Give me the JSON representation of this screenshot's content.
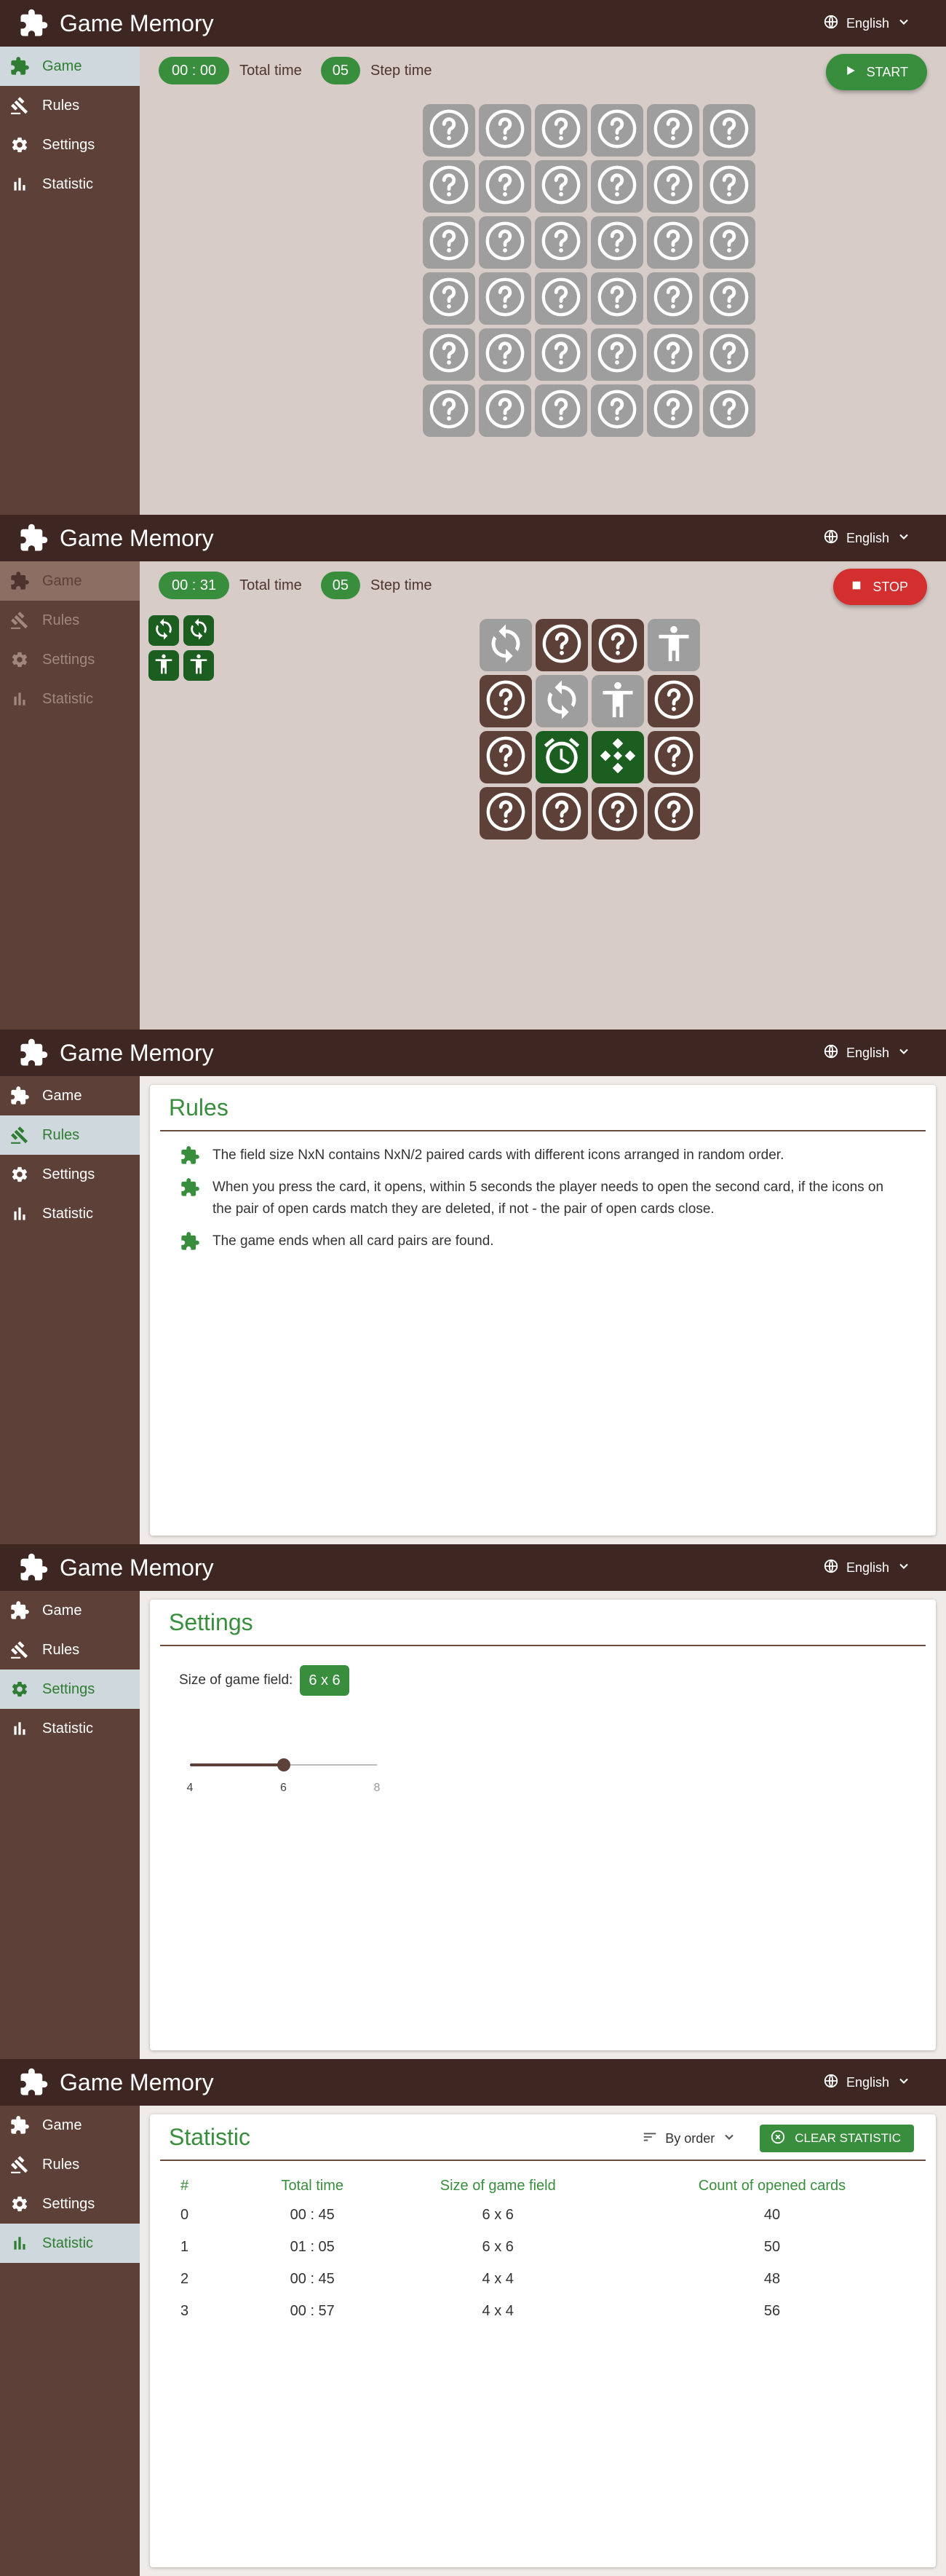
{
  "app": {
    "title": "Game Memory",
    "language": "English"
  },
  "nav": [
    {
      "label": "Game",
      "icon": "puzzle-icon"
    },
    {
      "label": "Rules",
      "icon": "gavel-icon"
    },
    {
      "label": "Settings",
      "icon": "gear-icon"
    },
    {
      "label": "Statistic",
      "icon": "bar-chart-icon"
    }
  ],
  "game1": {
    "total_time": "00 : 00",
    "total_label": "Total time",
    "step_time": "05",
    "step_label": "Step time",
    "button_label": "START",
    "grid_size": 6,
    "cards": [
      "question",
      "question",
      "question",
      "question",
      "question",
      "question",
      "question",
      "question",
      "question",
      "question",
      "question",
      "question",
      "question",
      "question",
      "question",
      "question",
      "question",
      "question",
      "question",
      "question",
      "question",
      "question",
      "question",
      "question",
      "question",
      "question",
      "question",
      "question",
      "question",
      "question",
      "question",
      "question",
      "question",
      "question",
      "question",
      "question"
    ]
  },
  "game2": {
    "total_time": "00 : 31",
    "total_label": "Total time",
    "step_time": "05",
    "step_label": "Step time",
    "button_label": "STOP",
    "grid_size": 4,
    "found": [
      "sync-icon",
      "sync-icon",
      "person-icon",
      "person-icon"
    ],
    "cards": [
      {
        "icon": "sync-icon",
        "state": "deleted"
      },
      {
        "icon": "question-icon",
        "state": "closed"
      },
      {
        "icon": "question-icon",
        "state": "closed"
      },
      {
        "icon": "person-icon",
        "state": "deleted"
      },
      {
        "icon": "question-icon",
        "state": "closed"
      },
      {
        "icon": "sync-icon",
        "state": "deleted"
      },
      {
        "icon": "person-icon",
        "state": "deleted"
      },
      {
        "icon": "question-icon",
        "state": "closed"
      },
      {
        "icon": "question-icon",
        "state": "closed"
      },
      {
        "icon": "alarm-icon",
        "state": "open"
      },
      {
        "icon": "diamond-icon",
        "state": "open"
      },
      {
        "icon": "question-icon",
        "state": "closed"
      },
      {
        "icon": "question-icon",
        "state": "closed"
      },
      {
        "icon": "question-icon",
        "state": "closed"
      },
      {
        "icon": "question-icon",
        "state": "closed"
      },
      {
        "icon": "question-icon",
        "state": "closed"
      }
    ]
  },
  "rules": {
    "title": "Rules",
    "items": [
      "The field size NxN contains NxN/2 paired cards with different icons arranged in random order.",
      "When you press the card, it opens, within 5 seconds the player needs to open the second card, if the icons on the pair of open cards match they are deleted, if not - the pair of open cards close.",
      "The game ends when all card pairs are found."
    ]
  },
  "settings": {
    "title": "Settings",
    "size_label": "Size of game field:",
    "size_value": "6 x 6",
    "slider": {
      "min": 4,
      "max": 8,
      "value": 6,
      "ticks": [
        "4",
        "6",
        "8"
      ]
    }
  },
  "statistic": {
    "title": "Statistic",
    "sort_label": "By order",
    "clear_label": "CLEAR STATISTIC",
    "columns": [
      "#",
      "Total time",
      "Size of game field",
      "Count of opened cards"
    ],
    "rows": [
      [
        "0",
        "00 : 45",
        "6 x 6",
        "40"
      ],
      [
        "1",
        "01 : 05",
        "6 x 6",
        "50"
      ],
      [
        "2",
        "00 : 45",
        "4 x 4",
        "48"
      ],
      [
        "3",
        "00 : 57",
        "4 x 4",
        "56"
      ]
    ]
  },
  "colors": {
    "appbar": "#3e2723",
    "sidebar": "#5d4037",
    "accent": "#388e3c",
    "stop": "#d32f2f",
    "card_closed": "#5d4037",
    "card_deleted": "#9e9e9e",
    "card_open": "#1b5e20"
  }
}
